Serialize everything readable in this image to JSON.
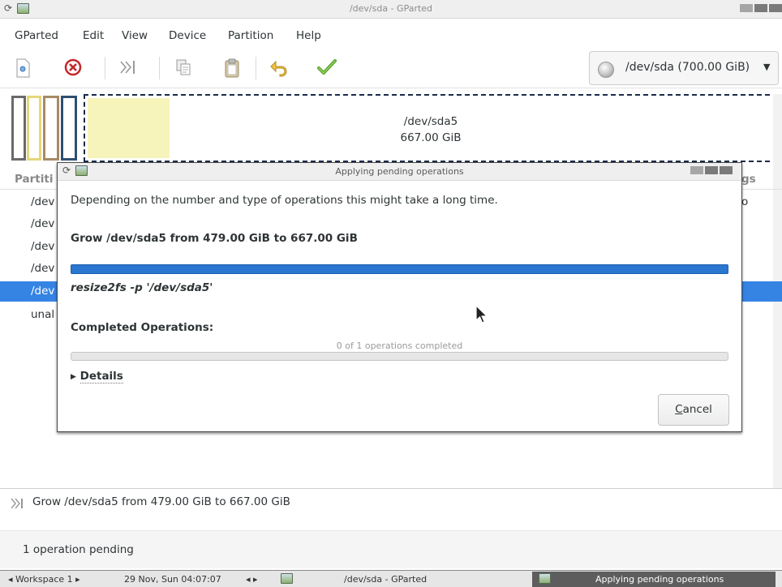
{
  "window": {
    "title": "/dev/sda - GParted",
    "spinner_glyph": "⟳"
  },
  "menubar": {
    "items": [
      "GParted",
      "Edit",
      "View",
      "Device",
      "Partition",
      "Help"
    ]
  },
  "toolbar": {
    "icons": [
      "new-partition-icon",
      "delete-icon",
      "resize-move-icon",
      "copy-icon",
      "paste-icon",
      "undo-icon",
      "apply-icon"
    ],
    "device_label": "/dev/sda (700.00 GiB)",
    "device_arrow": "▼"
  },
  "diskmap": {
    "selected_name": "/dev/sda5",
    "selected_size": "667.00 GiB"
  },
  "partition_list": {
    "header": "Partiti",
    "header_right": "gs",
    "rows": [
      "/dev",
      "/dev",
      "/dev",
      "/dev",
      "/dev",
      "unal"
    ],
    "row1_trailing": "o",
    "selected_row": 4
  },
  "dialog": {
    "title": "Applying pending operations",
    "description": "Depending on the number and type of operations this might take a long time.",
    "current_operation": "Grow /dev/sda5 from 479.00 GiB to 667.00 GiB",
    "current_progress": 1.0,
    "command": "resize2fs -p '/dev/sda5'",
    "completed_label": "Completed Operations:",
    "completed_count": "0 of 1 operations completed",
    "total_progress": 0.0,
    "details_arrow": "▶",
    "details_label": "Details",
    "cancel_label": "Cancel"
  },
  "operations_pane": {
    "items": [
      "Grow /dev/sda5 from 479.00 GiB to 667.00 GiB"
    ]
  },
  "statusbar": {
    "text": "1 operation pending"
  },
  "taskbar": {
    "workspace": "◂ Workspace 1 ▸",
    "clock": "29 Nov, Sun 04:07:07",
    "arrows": "◂ ▸",
    "task1": "/dev/sda - GParted",
    "task2": "Applying pending operations"
  },
  "colors": {
    "selection": "#3584e4",
    "progress": "#2a76d0",
    "used_space": "#f7f4bb"
  }
}
